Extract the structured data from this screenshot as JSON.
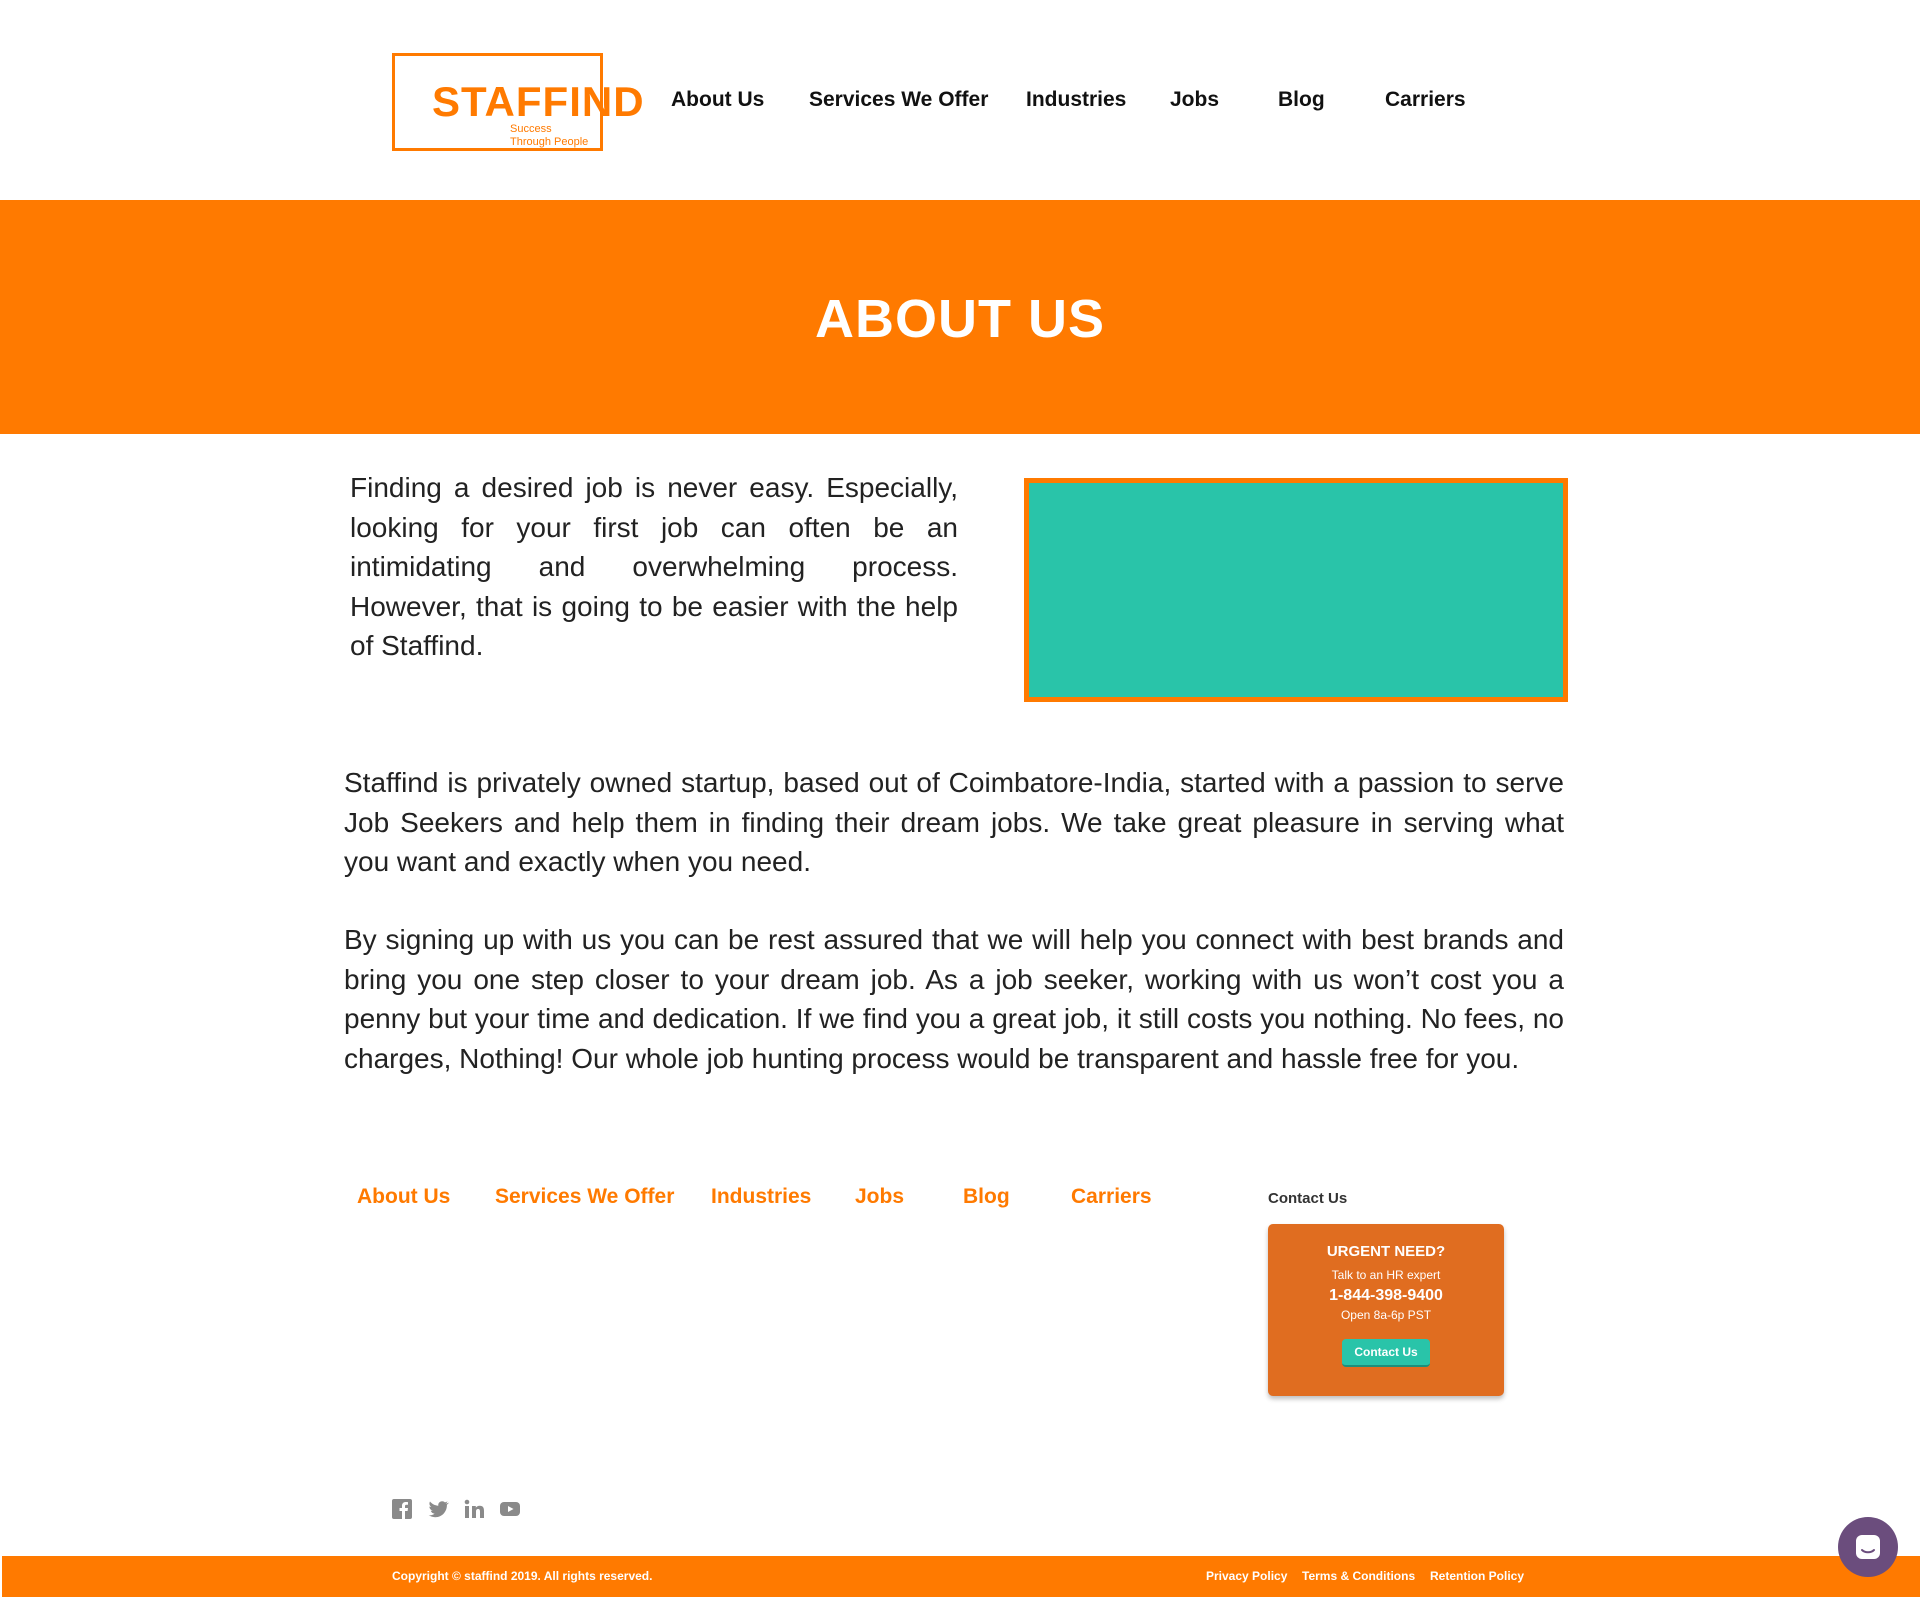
{
  "header": {
    "logo": {
      "word": "STAFFIND",
      "tagline_line1": "Success",
      "tagline_line2": "Through People"
    },
    "nav": [
      "About Us",
      "Services We Offer",
      "Industries",
      "Jobs",
      "Blog",
      "Carriers"
    ]
  },
  "hero": {
    "title": "ABOUT US"
  },
  "content": {
    "intro": "Finding a desired job is never easy. Especially, looking for your first job can often be an intimidating and overwhelming process. However, that is going to be easier with the help of Staffind.",
    "para1": "Staffind is privately owned startup, based out of Coimbatore-India, started with a passion to serve Job Seekers and help them in finding their dream jobs. We take great pleasure in serving what you want and exactly when you need.",
    "para2": "By signing up with us you can be rest assured that we will help you connect with best brands and bring you one step closer to your dream job. As a job seeker, working with us won’t cost you a penny but your time and dedication. If we find you a great job, it still costs you nothing. No fees, no charges, Nothing! Our whole job hunting process would be transparent and hassle free for you."
  },
  "footer": {
    "nav": [
      "About Us",
      "Services We Offer",
      "Industries",
      "Jobs",
      "Blog",
      "Carriers"
    ],
    "contact_label": "Contact Us",
    "urgent": {
      "title": "URGENT NEED?",
      "subtitle": "Talk to an HR expert",
      "phone": "1-844-398-9400",
      "hours": "Open 8a-6p PST",
      "button": "Contact Us"
    },
    "social_icons": [
      "facebook-icon",
      "twitter-icon",
      "linkedin-icon",
      "youtube-icon"
    ],
    "copyright": "Copyright © staffind 2019. All rights reserved.",
    "legal": [
      "Privacy Policy",
      "Terms & Conditions",
      "Retention Policy"
    ]
  },
  "colors": {
    "brand_orange": "#ff7a00",
    "teal": "#29c4a9",
    "urgent_bg": "#e06d20",
    "chat": "#6b4d7d"
  }
}
